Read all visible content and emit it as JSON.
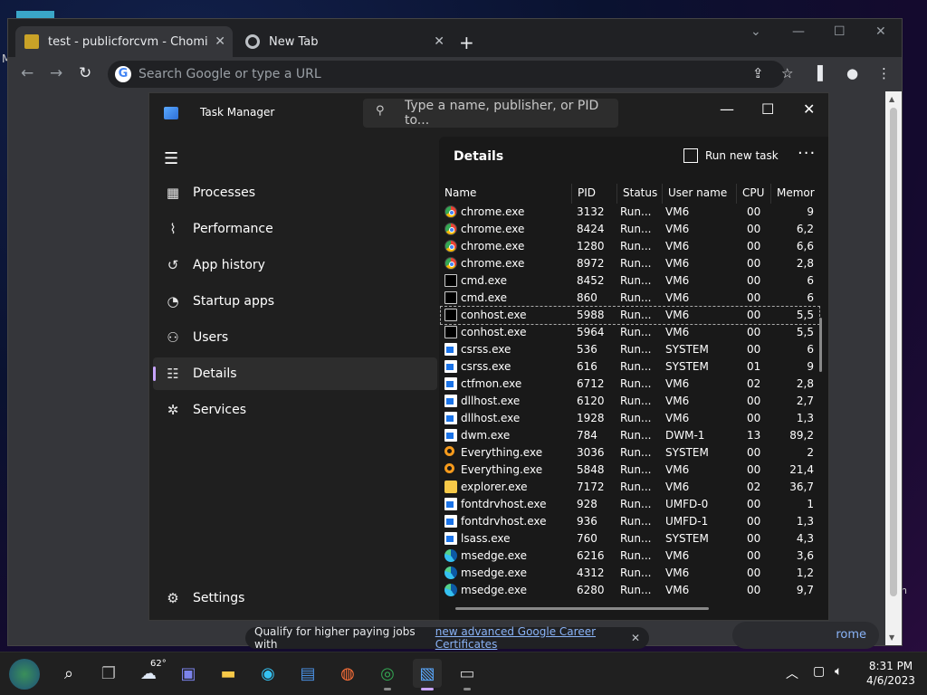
{
  "browser": {
    "tabs": [
      {
        "title": "test - publicforcvm - Chomikuj.pl"
      },
      {
        "title": "New Tab"
      }
    ],
    "omnibox_placeholder": "Search Google or type a URL",
    "ad": {
      "text": "Qualify for higher paying jobs with",
      "link": "new advanced Google Career Certificates"
    },
    "pill_text": "rome"
  },
  "task_manager": {
    "title": "Task Manager",
    "search_placeholder": "Type a name, publisher, or PID to...",
    "nav": [
      {
        "label": "Processes",
        "icon": "grid-icon"
      },
      {
        "label": "Performance",
        "icon": "chart-icon"
      },
      {
        "label": "App history",
        "icon": "history-icon"
      },
      {
        "label": "Startup apps",
        "icon": "speedometer-icon"
      },
      {
        "label": "Users",
        "icon": "users-icon"
      },
      {
        "label": "Details",
        "icon": "list-icon",
        "selected": true
      },
      {
        "label": "Services",
        "icon": "puzzle-icon"
      }
    ],
    "settings_label": "Settings",
    "details": {
      "title": "Details",
      "run_new_task": "Run new task",
      "columns": [
        "Name",
        "PID",
        "Status",
        "User name",
        "CPU",
        "Memor"
      ],
      "rows": [
        {
          "name": "chrome.exe",
          "pid": "3132",
          "status": "Run...",
          "user": "VM6",
          "cpu": "00",
          "mem": "9",
          "icon": "chrome"
        },
        {
          "name": "chrome.exe",
          "pid": "8424",
          "status": "Run...",
          "user": "VM6",
          "cpu": "00",
          "mem": "6,2",
          "icon": "chrome"
        },
        {
          "name": "chrome.exe",
          "pid": "1280",
          "status": "Run...",
          "user": "VM6",
          "cpu": "00",
          "mem": "6,6",
          "icon": "chrome"
        },
        {
          "name": "chrome.exe",
          "pid": "8972",
          "status": "Run...",
          "user": "VM6",
          "cpu": "00",
          "mem": "2,8",
          "icon": "chrome"
        },
        {
          "name": "cmd.exe",
          "pid": "8452",
          "status": "Run...",
          "user": "VM6",
          "cpu": "00",
          "mem": "6",
          "icon": "cmd"
        },
        {
          "name": "cmd.exe",
          "pid": "860",
          "status": "Run...",
          "user": "VM6",
          "cpu": "00",
          "mem": "6",
          "icon": "cmd"
        },
        {
          "name": "conhost.exe",
          "pid": "5988",
          "status": "Run...",
          "user": "VM6",
          "cpu": "00",
          "mem": "5,5",
          "icon": "cmd",
          "selected": true
        },
        {
          "name": "conhost.exe",
          "pid": "5964",
          "status": "Run...",
          "user": "VM6",
          "cpu": "00",
          "mem": "5,5",
          "icon": "cmd"
        },
        {
          "name": "csrss.exe",
          "pid": "536",
          "status": "Run...",
          "user": "SYSTEM",
          "cpu": "00",
          "mem": "6",
          "icon": "sys"
        },
        {
          "name": "csrss.exe",
          "pid": "616",
          "status": "Run...",
          "user": "SYSTEM",
          "cpu": "01",
          "mem": "9",
          "icon": "sys"
        },
        {
          "name": "ctfmon.exe",
          "pid": "6712",
          "status": "Run...",
          "user": "VM6",
          "cpu": "02",
          "mem": "2,8",
          "icon": "sys"
        },
        {
          "name": "dllhost.exe",
          "pid": "6120",
          "status": "Run...",
          "user": "VM6",
          "cpu": "00",
          "mem": "2,7",
          "icon": "sys"
        },
        {
          "name": "dllhost.exe",
          "pid": "1928",
          "status": "Run...",
          "user": "VM6",
          "cpu": "00",
          "mem": "1,3",
          "icon": "sys"
        },
        {
          "name": "dwm.exe",
          "pid": "784",
          "status": "Run...",
          "user": "DWM-1",
          "cpu": "13",
          "mem": "89,2",
          "icon": "sys"
        },
        {
          "name": "Everything.exe",
          "pid": "3036",
          "status": "Run...",
          "user": "SYSTEM",
          "cpu": "00",
          "mem": "2",
          "icon": "every"
        },
        {
          "name": "Everything.exe",
          "pid": "5848",
          "status": "Run...",
          "user": "VM6",
          "cpu": "00",
          "mem": "21,4",
          "icon": "every"
        },
        {
          "name": "explorer.exe",
          "pid": "7172",
          "status": "Run...",
          "user": "VM6",
          "cpu": "02",
          "mem": "36,7",
          "icon": "explorer"
        },
        {
          "name": "fontdrvhost.exe",
          "pid": "928",
          "status": "Run...",
          "user": "UMFD-0",
          "cpu": "00",
          "mem": "1",
          "icon": "sys"
        },
        {
          "name": "fontdrvhost.exe",
          "pid": "936",
          "status": "Run...",
          "user": "UMFD-1",
          "cpu": "00",
          "mem": "1,3",
          "icon": "sys"
        },
        {
          "name": "lsass.exe",
          "pid": "760",
          "status": "Run...",
          "user": "SYSTEM",
          "cpu": "00",
          "mem": "4,3",
          "icon": "sys"
        },
        {
          "name": "msedge.exe",
          "pid": "6216",
          "status": "Run...",
          "user": "VM6",
          "cpu": "00",
          "mem": "3,6",
          "icon": "edge"
        },
        {
          "name": "msedge.exe",
          "pid": "4312",
          "status": "Run...",
          "user": "VM6",
          "cpu": "00",
          "mem": "1,2",
          "icon": "edge"
        },
        {
          "name": "msedge.exe",
          "pid": "6280",
          "status": "Run...",
          "user": "VM6",
          "cpu": "00",
          "mem": "9,7",
          "icon": "edge"
        }
      ]
    }
  },
  "taskbar": {
    "weather_temp": "62°",
    "time": "8:31 PM",
    "date": "4/6/2023"
  }
}
